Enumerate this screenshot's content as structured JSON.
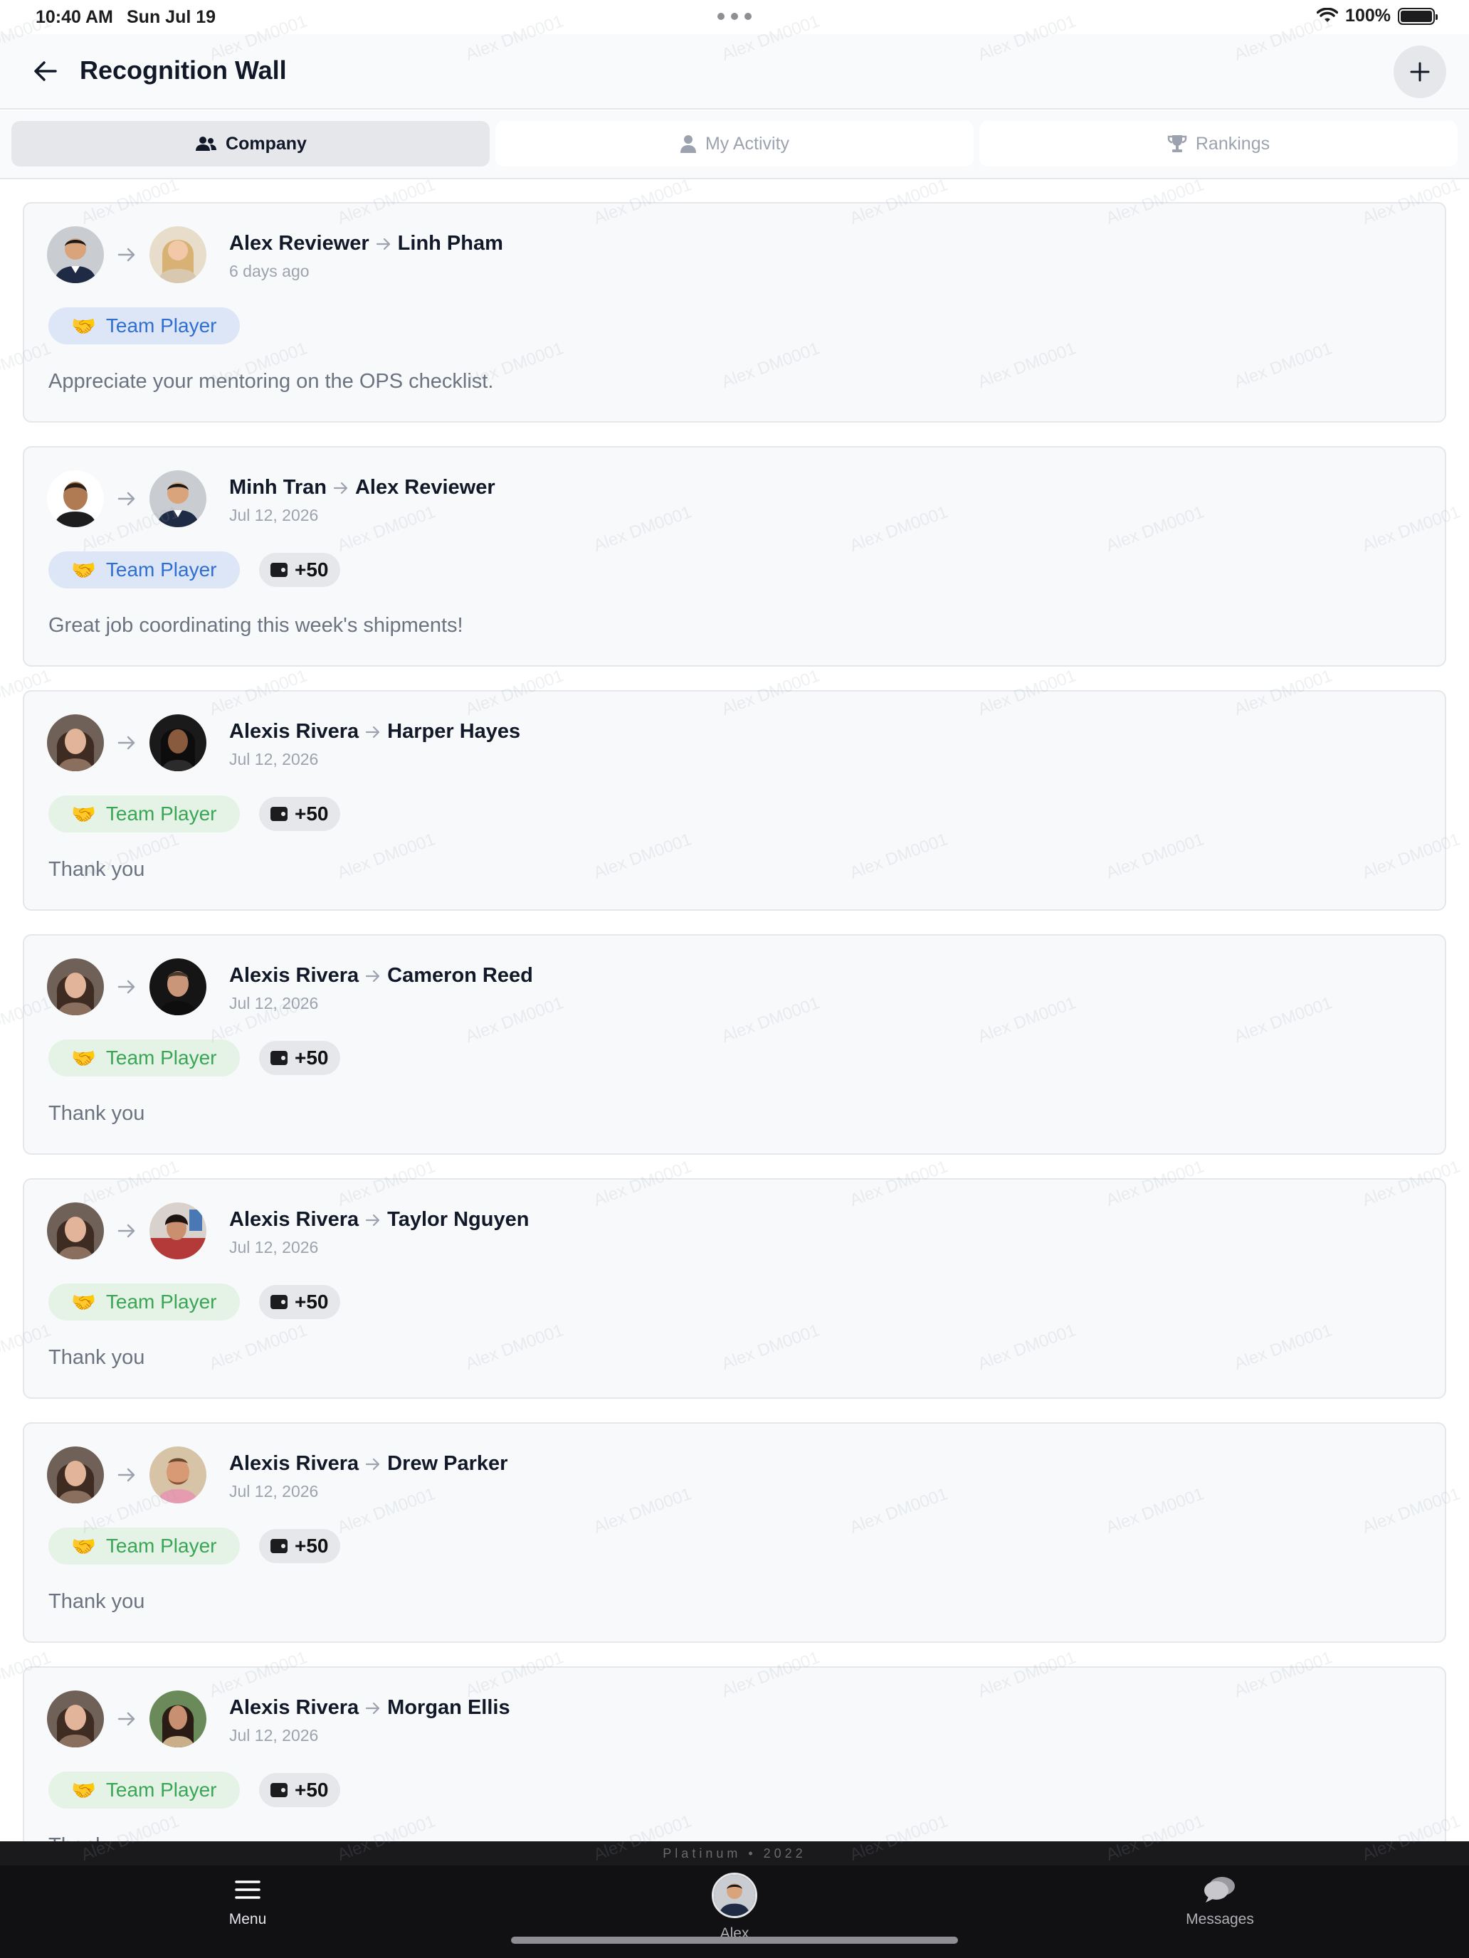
{
  "status_bar": {
    "time": "10:40 AM",
    "date": "Sun Jul 19",
    "battery": "100%"
  },
  "header": {
    "title": "Recognition Wall"
  },
  "tabs": [
    {
      "label": "Company",
      "icon": "people-icon",
      "active": true
    },
    {
      "label": "My Activity",
      "icon": "person-icon",
      "active": false
    },
    {
      "label": "Rankings",
      "icon": "trophy-icon",
      "active": false
    }
  ],
  "feed": [
    {
      "from": "Alex Reviewer",
      "to": "Linh Pham",
      "date": "6 days ago",
      "badge": "Team Player",
      "badge_emoji": "🤝",
      "badge_color": "blue",
      "points": "",
      "message": "Appreciate your mentoring on the OPS checklist."
    },
    {
      "from": "Minh Tran",
      "to": "Alex Reviewer",
      "date": "Jul 12, 2026",
      "badge": "Team Player",
      "badge_emoji": "🤝",
      "badge_color": "blue",
      "points": "+50",
      "message": "Great job coordinating this week's shipments!"
    },
    {
      "from": "Alexis Rivera",
      "to": "Harper Hayes",
      "date": "Jul 12, 2026",
      "badge": "Team Player",
      "badge_emoji": "🤝",
      "badge_color": "green",
      "points": "+50",
      "message": "Thank you"
    },
    {
      "from": "Alexis Rivera",
      "to": "Cameron Reed",
      "date": "Jul 12, 2026",
      "badge": "Team Player",
      "badge_emoji": "🤝",
      "badge_color": "green",
      "points": "+50",
      "message": "Thank you"
    },
    {
      "from": "Alexis Rivera",
      "to": "Taylor Nguyen",
      "date": "Jul 12, 2026",
      "badge": "Team Player",
      "badge_emoji": "🤝",
      "badge_color": "green",
      "points": "+50",
      "message": "Thank you"
    },
    {
      "from": "Alexis Rivera",
      "to": "Drew Parker",
      "date": "Jul 12, 2026",
      "badge": "Team Player",
      "badge_emoji": "🤝",
      "badge_color": "green",
      "points": "+50",
      "message": "Thank you"
    },
    {
      "from": "Alexis Rivera",
      "to": "Morgan Ellis",
      "date": "Jul 12, 2026",
      "badge": "Team Player",
      "badge_emoji": "🤝",
      "badge_color": "green",
      "points": "+50",
      "message": "Thank you"
    }
  ],
  "footer_brand": "Platinum  •  2022",
  "bottom_nav": [
    {
      "label": "Menu",
      "icon": "menu-icon"
    },
    {
      "label": "Alex",
      "icon": "avatar"
    },
    {
      "label": "Messages",
      "icon": "chat-icon"
    }
  ],
  "watermark": "Alex DM0001"
}
